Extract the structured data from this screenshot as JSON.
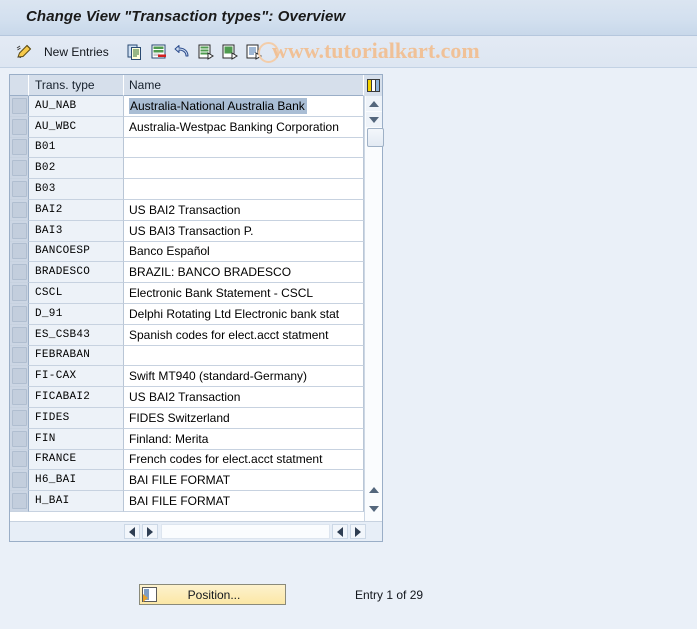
{
  "window": {
    "title": "Change View \"Transaction types\": Overview"
  },
  "watermark": {
    "text": "www.tutorialkart.com"
  },
  "toolbar": {
    "items": [
      {
        "icon": "pencil-edit-icon",
        "label": ""
      },
      {
        "icon": "",
        "label": "New Entries"
      },
      {
        "icon": "copy-as-icon",
        "label": ""
      },
      {
        "icon": "delete-row-icon",
        "label": ""
      },
      {
        "icon": "undo-arrow-icon",
        "label": ""
      },
      {
        "icon": "select-all-icon",
        "label": ""
      },
      {
        "icon": "select-block-icon",
        "label": ""
      },
      {
        "icon": "deselect-all-icon",
        "label": ""
      }
    ],
    "new_entries_label": "New Entries"
  },
  "table": {
    "config_icon": "table-settings-icon",
    "columns": [
      "Trans. type",
      "Name"
    ],
    "rows": [
      {
        "type": "AU_NAB",
        "name": "Australia-National Australia Bank",
        "selected": true
      },
      {
        "type": "AU_WBC",
        "name": "Australia-Westpac Banking Corporation",
        "selected": false
      },
      {
        "type": "B01",
        "name": "",
        "selected": false
      },
      {
        "type": "B02",
        "name": "",
        "selected": false
      },
      {
        "type": "B03",
        "name": "",
        "selected": false
      },
      {
        "type": "BAI2",
        "name": "US BAI2 Transaction",
        "selected": false
      },
      {
        "type": "BAI3",
        "name": "US BAI3 Transaction P.",
        "selected": false
      },
      {
        "type": "BANCOESP",
        "name": "Banco Español",
        "selected": false
      },
      {
        "type": "BRADESCO",
        "name": "BRAZIL: BANCO BRADESCO",
        "selected": false
      },
      {
        "type": "CSCL",
        "name": "Electronic Bank Statement - CSCL",
        "selected": false
      },
      {
        "type": "D_91",
        "name": "Delphi Rotating Ltd Electronic bank stat",
        "selected": false
      },
      {
        "type": "ES_CSB43",
        "name": "Spanish codes for elect.acct statment",
        "selected": false
      },
      {
        "type": "FEBRABAN",
        "name": "",
        "selected": false
      },
      {
        "type": "FI-CAX",
        "name": "Swift MT940 (standard-Germany)",
        "selected": false
      },
      {
        "type": "FICABAI2",
        "name": "US BAI2 Transaction",
        "selected": false
      },
      {
        "type": "FIDES",
        "name": "FIDES Switzerland",
        "selected": false
      },
      {
        "type": "FIN",
        "name": "Finland: Merita",
        "selected": false
      },
      {
        "type": "FRANCE",
        "name": "French codes for elect.acct statment",
        "selected": false
      },
      {
        "type": "H6_BAI",
        "name": "BAI FILE FORMAT",
        "selected": false
      },
      {
        "type": "H_BAI",
        "name": "BAI FILE FORMAT",
        "selected": false
      }
    ]
  },
  "footer": {
    "position_button_label": "Position...",
    "entry_status": "Entry 1 of 29"
  },
  "colors": {
    "background": "#eaf0f8",
    "title_bar": "#d3e0ef",
    "header_row": "#d6dfeb",
    "selection": "#a9bdd4",
    "button_yellow": "#fbe7a6",
    "watermark": "#f0c197"
  }
}
